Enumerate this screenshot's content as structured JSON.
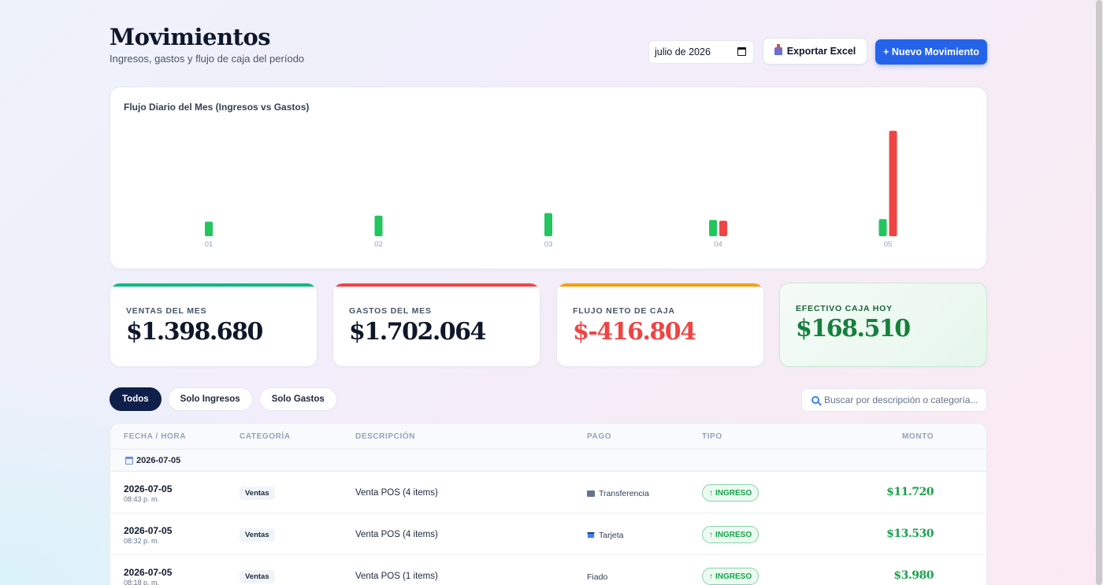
{
  "header": {
    "title": "Movimientos",
    "subtitle": "Ingresos, gastos y flujo de caja del período",
    "date_value": "julio de 2026",
    "export_label": "Exportar Excel",
    "new_label": "+ Nuevo Movimiento"
  },
  "chart_data": {
    "type": "bar",
    "title": "Flujo Diario del Mes (Ingresos vs Gastos)",
    "categories": [
      "01",
      "02",
      "03",
      "04",
      "05"
    ],
    "series": [
      {
        "values": [
          85000,
          120000,
          135000,
          95000,
          100000
        ],
        "color": "#22c55e"
      },
      {
        "values": [
          0,
          0,
          0,
          90000,
          615000
        ],
        "color": "#ef4444"
      }
    ],
    "ylim": [
      0,
      620000
    ],
    "grid": false,
    "legend": "none"
  },
  "stats": [
    {
      "label": "VENTAS DEL MES",
      "value": "$1.398.680",
      "color": "#10b981"
    },
    {
      "label": "GASTOS DEL MES",
      "value": "$1.702.064",
      "color": "#ef4444"
    },
    {
      "label": "FLUJO NETO DE CAJA",
      "value": "$-416.804",
      "color": "#f59e0b"
    },
    {
      "label": "EFECTIVO CAJA HOY",
      "value": "$168.510",
      "color": "#16a34a"
    }
  ],
  "filters": {
    "all": "Todos",
    "income": "Solo Ingresos",
    "expense": "Solo Gastos"
  },
  "search": {
    "placeholder": "Buscar por descripción o categoría..."
  },
  "table": {
    "headers": [
      "FECHA / HORA",
      "CATEGORÍA",
      "DESCRIPCIÓN",
      "PAGO",
      "TIPO",
      "MONTO"
    ],
    "group": "2026-07-05",
    "rows": [
      {
        "date": "2026-07-05",
        "time": "08:43 p. m.",
        "category": "Ventas",
        "description": "Venta POS (4 items)",
        "payment": "Transferencia",
        "payment_icon": "bank-icon",
        "type": "INGRESO",
        "amount": "$11.720"
      },
      {
        "date": "2026-07-05",
        "time": "08:32 p. m.",
        "category": "Ventas",
        "description": "Venta POS (4 items)",
        "payment": "Tarjeta",
        "payment_icon": "card-icon",
        "type": "INGRESO",
        "amount": "$13.530"
      },
      {
        "date": "2026-07-05",
        "time": "08:18 p. m.",
        "category": "Ventas",
        "description": "Venta POS (1 items)",
        "payment": "Fiado",
        "payment_icon": "",
        "type": "INGRESO",
        "amount": "$3.980"
      }
    ]
  }
}
